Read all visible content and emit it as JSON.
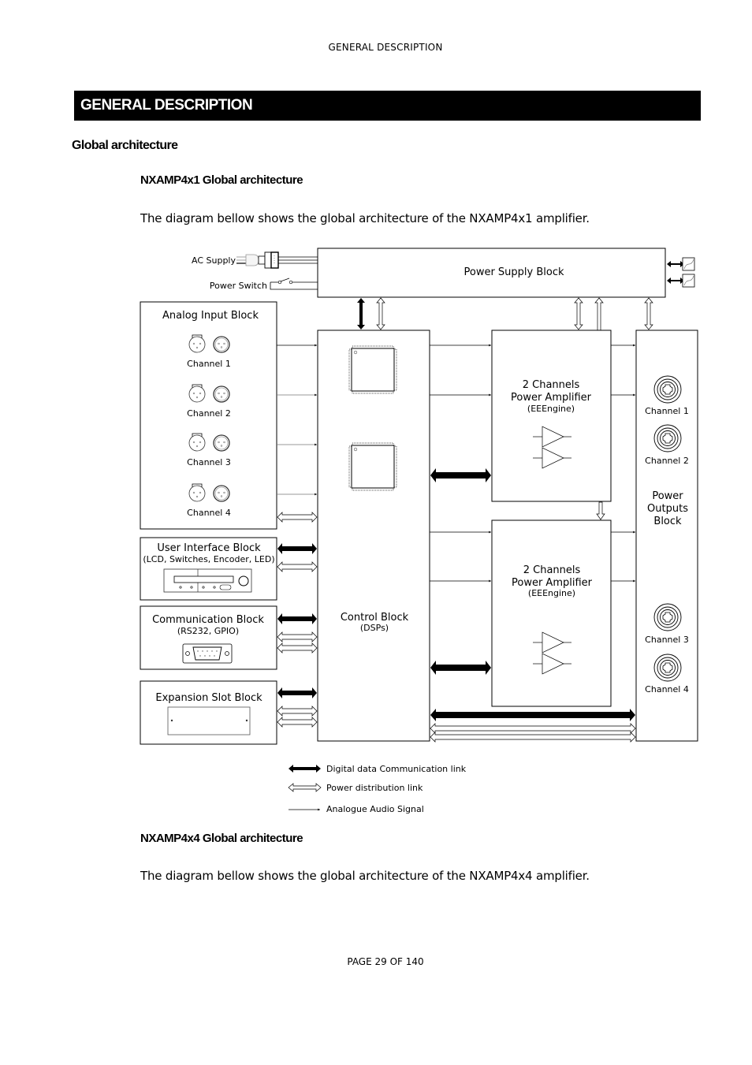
{
  "header": {
    "running_title": "GENERAL DESCRIPTION"
  },
  "section": {
    "title": "GENERAL DESCRIPTION"
  },
  "subsection": {
    "title": "Global architecture"
  },
  "nxamp4x1": {
    "title": "NXAMP4x1 Global architecture",
    "intro": "The diagram bellow shows the global architecture of the NXAMP4x1 amplifier."
  },
  "diagram": {
    "ac_supply": "AC Supply",
    "power_switch": "Power Switch",
    "power_supply_block": "Power Supply Block",
    "analog_input_block": {
      "title": "Analog Input Block",
      "channels": [
        "Channel 1",
        "Channel 2",
        "Channel 3",
        "Channel 4"
      ]
    },
    "user_interface_block": {
      "title": "User Interface Block",
      "subtitle": "(LCD, Switches, Encoder, LED)"
    },
    "communication_block": {
      "title": "Communication Block",
      "subtitle": "(RS232, GPIO)"
    },
    "expansion_slot_block": {
      "title": "Expansion Slot Block"
    },
    "control_block": {
      "title": "Control Block",
      "subtitle": "(DSPs)"
    },
    "amplifier_1": {
      "line1": "2 Channels",
      "line2": "Power Amplifier",
      "subtitle": "(EEEngine)"
    },
    "amplifier_2": {
      "line1": "2 Channels",
      "line2": "Power Amplifier",
      "subtitle": "(EEEngine)"
    },
    "power_outputs_block": {
      "title_lines": [
        "Power",
        "Outputs",
        "Block"
      ],
      "channels": [
        "Channel 1",
        "Channel 2",
        "Channel 3",
        "Channel 4"
      ]
    },
    "legend": [
      {
        "type": "digital",
        "label": "Digital data Communication link"
      },
      {
        "type": "power",
        "label": "Power distribution link"
      },
      {
        "type": "analog",
        "label": "Analogue Audio Signal"
      }
    ]
  },
  "nxamp4x4": {
    "title": "NXAMP4x4 Global architecture",
    "intro": "The diagram bellow shows the global architecture of the NXAMP4x4 amplifier."
  },
  "footer": {
    "page_label": "PAGE 29 OF 140"
  }
}
